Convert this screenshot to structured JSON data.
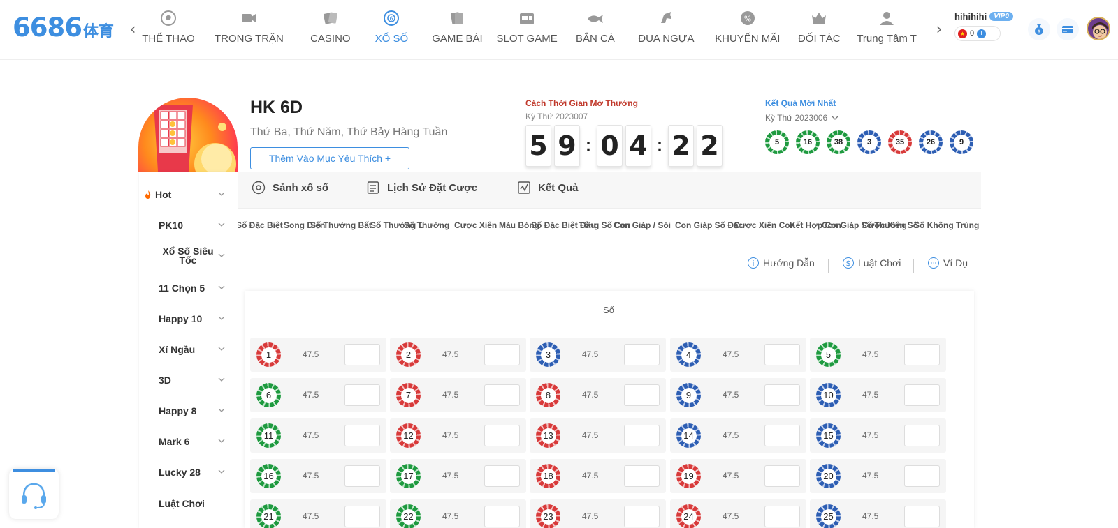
{
  "brand": {
    "logo_number": "6686",
    "logo_cn": "体育"
  },
  "nav": {
    "items": [
      {
        "label": "THỂ THAO",
        "icon": "soccer-ball-icon"
      },
      {
        "label": "TRONG TRẬN",
        "icon": "video-camera-icon"
      },
      {
        "label": "CASINO",
        "icon": "playing-cards-icon"
      },
      {
        "label": "XỔ SỐ",
        "icon": "lottery-ball-icon",
        "active": true
      },
      {
        "label": "GAME BÀI",
        "icon": "card-game-icon"
      },
      {
        "label": "SLOT GAME",
        "icon": "slot-machine-icon"
      },
      {
        "label": "BẮN CÁ",
        "icon": "fish-icon"
      },
      {
        "label": "ĐUA NGỰA",
        "icon": "horse-icon"
      },
      {
        "label": "KHUYẾN MÃI",
        "icon": "percent-badge-icon"
      },
      {
        "label": "ĐỐI TÁC",
        "icon": "crown-icon"
      },
      {
        "label": "Trung Tâm T",
        "icon": "user-center-icon"
      }
    ]
  },
  "user": {
    "name": "hihihihi",
    "vip": "VIP0",
    "balance": "0"
  },
  "game": {
    "title": "HK 6D",
    "schedule": "Thứ Ba, Thứ Năm, Thứ Bảy Hàng Tuần",
    "favorite_label": "Thêm Vào Mục Yêu Thích +"
  },
  "countdown": {
    "label": "Cách Thời Gian Mở Thưởng",
    "issue": "Kỳ Thứ 2023007",
    "digits": [
      "5",
      "9",
      "0",
      "4",
      "2",
      "2"
    ]
  },
  "latest": {
    "label": "Kết Quả Mới Nhất",
    "issue": "Kỳ Thứ 2023006",
    "balls": [
      {
        "n": "5",
        "color": "green"
      },
      {
        "n": "16",
        "color": "green"
      },
      {
        "n": "38",
        "color": "green"
      },
      {
        "n": "3",
        "color": "blue"
      },
      {
        "n": "35",
        "color": "red"
      },
      {
        "n": "26",
        "color": "blue"
      },
      {
        "n": "9",
        "color": "blue"
      }
    ]
  },
  "sidebar": {
    "items": [
      {
        "label": "Hot",
        "fire": true
      },
      {
        "label": "PK10"
      },
      {
        "label": "Xổ Số Siêu Tốc"
      },
      {
        "label": "11 Chọn 5"
      },
      {
        "label": "Happy 10"
      },
      {
        "label": "Xí Ngầu"
      },
      {
        "label": "3D"
      },
      {
        "label": "Happy 8"
      },
      {
        "label": "Mark 6"
      },
      {
        "label": "Lucky 28"
      },
      {
        "label": "Luật Chơi",
        "no_chevron": true
      }
    ]
  },
  "main_tabs": [
    {
      "label": "Sảnh xổ số",
      "icon": "lottery-hall-icon"
    },
    {
      "label": "Lịch Sử Đặt Cược",
      "icon": "bet-history-icon"
    },
    {
      "label": "Kết Quả",
      "icon": "result-chart-icon"
    }
  ],
  "sub_tabs": [
    "Số Đặc Biệt",
    "Song Diện",
    "Số Thường Bất",
    "Số Thường 1",
    "Số Thường",
    "Cược Xiên",
    "Màu Bóng",
    "Số Đặc Biệt Đầu",
    "Tổng Số Con",
    "Con Giáp / Sói",
    "Con Giáp Số Đặc",
    "Cược Xiên Con",
    "Kết Hợp Con",
    "Con Giáp Số Thường",
    "Cược Xiên Số",
    "Số Không Trúng"
  ],
  "help_links": [
    {
      "label": "Hướng Dẫn",
      "icon": "info-icon",
      "glyph": "i"
    },
    {
      "label": "Luật Chơi",
      "icon": "dollar-icon",
      "glyph": "$"
    },
    {
      "label": "Ví Dụ",
      "icon": "more-dots-icon",
      "glyph": "···"
    }
  ],
  "board": {
    "header": "Số",
    "odds": "47.5",
    "numbers": [
      {
        "n": "1",
        "color": "red"
      },
      {
        "n": "2",
        "color": "red"
      },
      {
        "n": "3",
        "color": "blue"
      },
      {
        "n": "4",
        "color": "blue"
      },
      {
        "n": "5",
        "color": "green"
      },
      {
        "n": "6",
        "color": "green"
      },
      {
        "n": "7",
        "color": "red"
      },
      {
        "n": "8",
        "color": "red"
      },
      {
        "n": "9",
        "color": "blue"
      },
      {
        "n": "10",
        "color": "blue"
      },
      {
        "n": "11",
        "color": "green"
      },
      {
        "n": "12",
        "color": "red"
      },
      {
        "n": "13",
        "color": "red"
      },
      {
        "n": "14",
        "color": "blue"
      },
      {
        "n": "15",
        "color": "blue"
      },
      {
        "n": "16",
        "color": "green"
      },
      {
        "n": "17",
        "color": "green"
      },
      {
        "n": "18",
        "color": "red"
      },
      {
        "n": "19",
        "color": "red"
      },
      {
        "n": "20",
        "color": "blue"
      },
      {
        "n": "21",
        "color": "green"
      },
      {
        "n": "22",
        "color": "green"
      },
      {
        "n": "23",
        "color": "red"
      },
      {
        "n": "24",
        "color": "red"
      },
      {
        "n": "25",
        "color": "blue"
      }
    ]
  },
  "colors": {
    "accent": "#3d8ee0",
    "red_ball": "#d83a3a",
    "green_ball": "#1e9a3f",
    "blue_ball": "#2d5eb3"
  }
}
